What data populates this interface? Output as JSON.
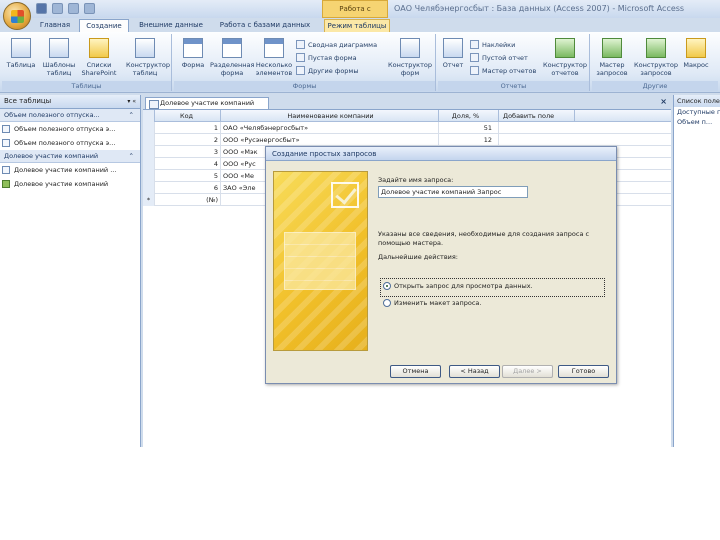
{
  "window": {
    "context_header": "Работа с таблицами",
    "title": "ОАО Челябэнергосбыт : База данных (Access 2007) - Microsoft Access"
  },
  "tabs": [
    "Главная",
    "Создание",
    "Внешние данные",
    "Работа с базами данных",
    "Режим таблицы"
  ],
  "ribbon": {
    "group_tables": {
      "label": "Таблицы",
      "buttons": [
        "Таблица",
        "Шаблоны таблиц",
        "Списки SharePoint",
        "Конструктор таблиц"
      ]
    },
    "group_forms": {
      "label": "Формы",
      "buttons": [
        "Форма",
        "Разделенная форма",
        "Несколько элементов",
        "Конструктор форм"
      ],
      "small": [
        "Сводная диаграмма",
        "Пустая форма",
        "Другие формы"
      ]
    },
    "group_reports": {
      "label": "Отчеты",
      "buttons": [
        "Отчет",
        "Конструктор отчетов"
      ],
      "small": [
        "Наклейки",
        "Пустой отчет",
        "Мастер отчетов"
      ]
    },
    "group_other": {
      "label": "Другие",
      "buttons": [
        "Мастер запросов",
        "Конструктор запросов",
        "Макрос"
      ]
    }
  },
  "nav": {
    "header": "Все таблицы",
    "groups": [
      {
        "title": "Объем полезного отпуска...",
        "items": [
          "Объем полезного отпуска э...",
          "Объем полезного отпуска э..."
        ]
      },
      {
        "title": "Долевое участие компаний",
        "items": [
          "Долевое участие компаний ...",
          "Долевое участие компаний"
        ]
      }
    ]
  },
  "document": {
    "tab": "Долевое участие компаний",
    "close": "×",
    "columns": [
      "Код",
      "Наименование компании",
      "Доля, %",
      "Добавить поле"
    ],
    "rows": [
      [
        "1",
        "ОАО «Челябэнергосбыт»",
        "51"
      ],
      [
        "2",
        "ООО «Русэнергосбыт»",
        "12"
      ],
      [
        "3",
        "ООО «Мэк",
        ""
      ],
      [
        "4",
        "ООО «Рус",
        ""
      ],
      [
        "5",
        "ООО «Ме",
        ""
      ],
      [
        "6",
        "ЗАО «Эле",
        ""
      ]
    ],
    "new_row_marker": "*",
    "new_row_id": "(№)"
  },
  "right_pane": {
    "title": "Список полей",
    "subtitle": "Доступные п...",
    "item": "Объем п..."
  },
  "dialog": {
    "title": "Создание простых запросов",
    "name_label": "Задайте имя запроса:",
    "name_value": "Долевое участие компаний Запрос",
    "info": [
      "Указаны все сведения, необходимые для создания запроса с",
      "помощью мастера."
    ],
    "next_action_label": "Дальнейшие действия:",
    "options": [
      "Открыть запрос для просмотра данных.",
      "Изменить макет запроса."
    ],
    "selected_option": 0,
    "buttons": [
      "Отмена",
      "< Назад",
      "Далее >",
      "Готово"
    ]
  }
}
